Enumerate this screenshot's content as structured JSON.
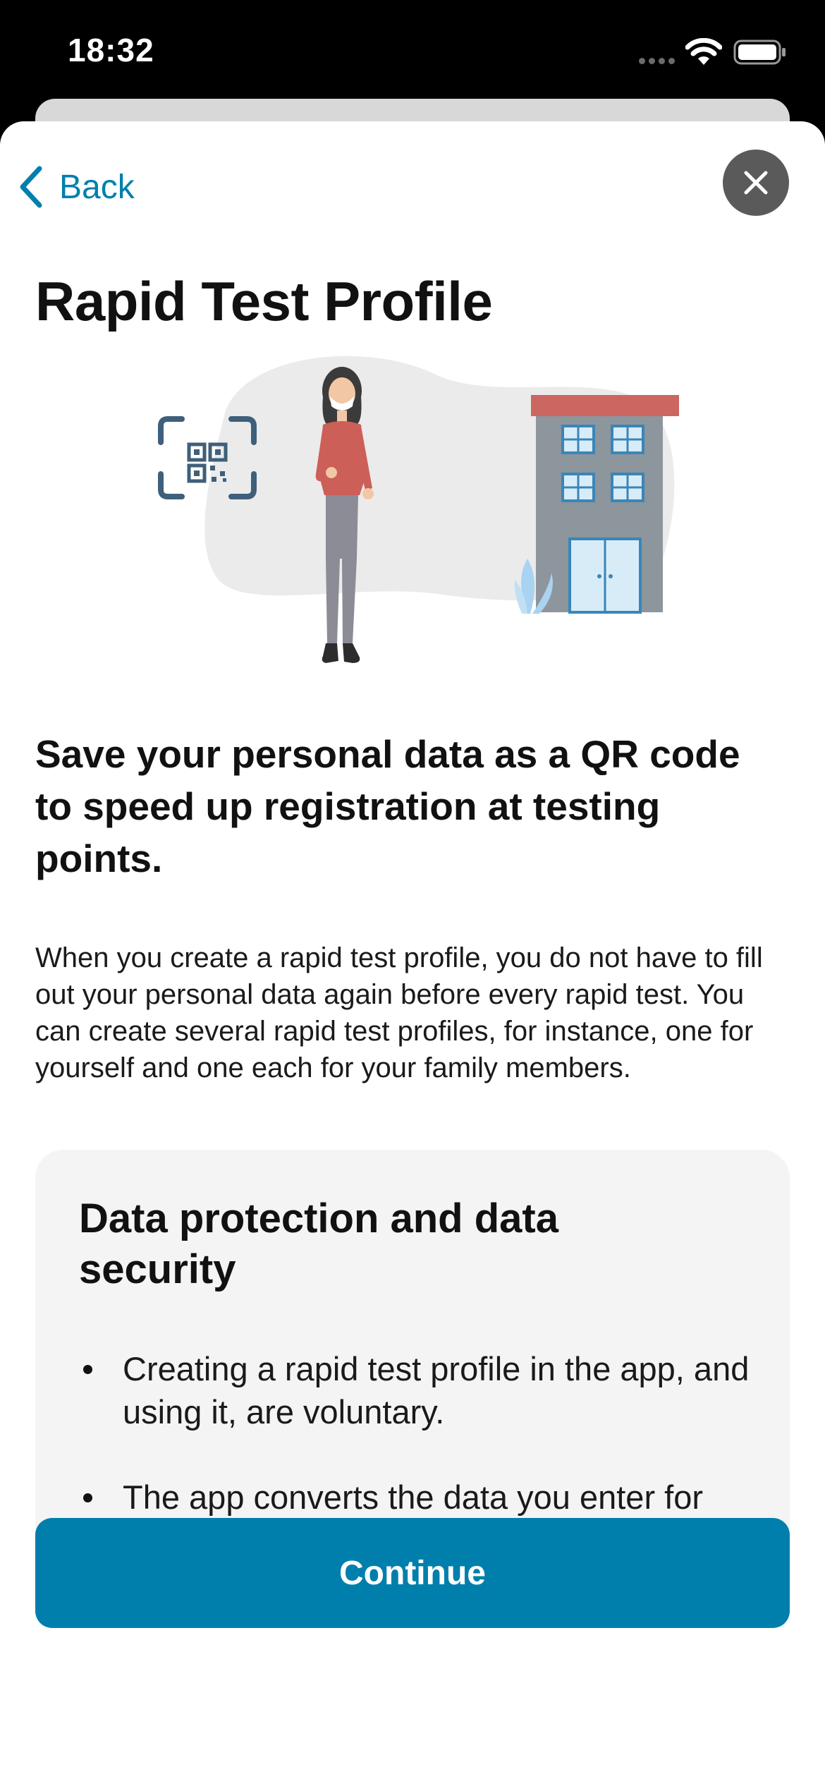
{
  "status_bar": {
    "time": "18:32",
    "icons": [
      "cellular-dots-icon",
      "wifi-icon",
      "battery-icon"
    ]
  },
  "nav": {
    "back_label": "Back",
    "back_icon": "chevron-left-icon",
    "close_icon": "close-icon"
  },
  "page": {
    "title": "Rapid Test Profile",
    "illustration_icons": [
      "qr-code-scan-icon",
      "person-with-mask",
      "building",
      "plant"
    ],
    "headline": "Save your personal data as a QR code to speed up registration at testing points.",
    "body": "When you create a rapid test profile, you do not have to fill out your personal data again before every rapid test. You can create several rapid test profiles, for instance, one for yourself and one each for your family members."
  },
  "info_box": {
    "title": "Data protection and data security",
    "items": [
      "Creating a rapid test profile in the app, and using it, are voluntary.",
      "The app converts the data you enter for your rapid test profile into your personal QR code. The QR code then"
    ]
  },
  "footer": {
    "continue_label": "Continue"
  },
  "colors": {
    "accent": "#007fad",
    "close_bg": "#5a5a5a",
    "info_bg": "#f4f4f4"
  }
}
